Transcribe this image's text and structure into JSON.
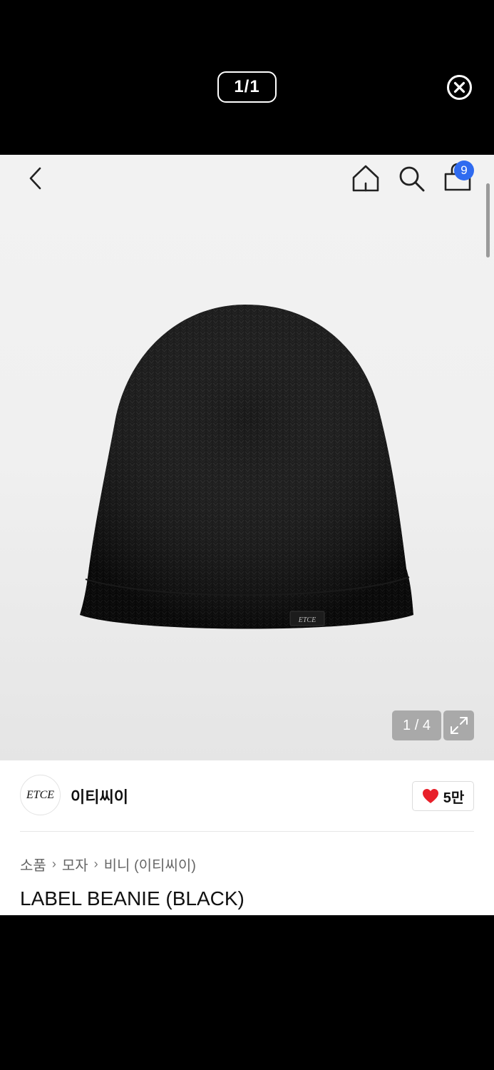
{
  "viewer": {
    "page_counter": "1/1",
    "close_icon": "close-circle-icon"
  },
  "header": {
    "back_icon": "chevron-left-icon",
    "home_icon": "home-icon",
    "search_icon": "search-icon",
    "cart_icon": "shopping-bag-icon",
    "cart_count": "9",
    "badge_color": "#2f6bf0"
  },
  "gallery": {
    "counter": "1 / 4",
    "expand_icon": "expand-icon",
    "label_text": "ETCE"
  },
  "brand": {
    "logo_text": "ETCE",
    "name": "이티씨이",
    "like_icon": "heart-icon",
    "like_color": "#e8202a",
    "like_count": "5만"
  },
  "breadcrumb": [
    "소품",
    "모자",
    "비니 (이티씨이)"
  ],
  "product": {
    "title": "LABEL BEANIE (BLACK)"
  }
}
